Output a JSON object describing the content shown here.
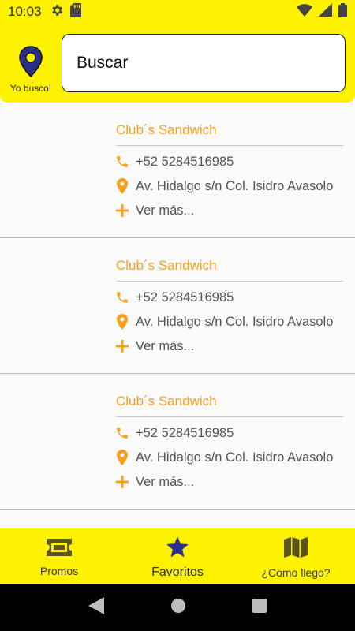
{
  "status_bar": {
    "time": "10:03",
    "icons": [
      "gear-icon",
      "sd-card-icon",
      "wifi-icon",
      "signal-icon",
      "battery-icon"
    ]
  },
  "header": {
    "brand_label": "Yo busco!",
    "search": {
      "placeholder": "Buscar"
    }
  },
  "colors": {
    "accent_yellow": "#fff200",
    "orange": "#f5a11c",
    "navy": "#2b2f8c"
  },
  "results": [
    {
      "name": "Club´s Sandwich",
      "phone": "+52 5284516985",
      "address": "Av. Hidalgo s/n Col. Isidro Avasolo",
      "more": "Ver más..."
    },
    {
      "name": "Club´s Sandwich",
      "phone": "+52 5284516985",
      "address": "Av. Hidalgo s/n Col. Isidro Avasolo",
      "more": "Ver más..."
    },
    {
      "name": "Club´s Sandwich",
      "phone": "+52 5284516985",
      "address": "Av. Hidalgo s/n Col. Isidro Avasolo",
      "more": "Ver más..."
    }
  ],
  "bottom_nav": {
    "items": [
      {
        "label": "Promos",
        "icon": "ticket-icon"
      },
      {
        "label": "Favoritos",
        "icon": "star-icon",
        "active": true
      },
      {
        "label": "¿Como llego?",
        "icon": "map-icon"
      }
    ]
  },
  "system_nav": [
    "back-icon",
    "home-icon",
    "recents-icon"
  ]
}
